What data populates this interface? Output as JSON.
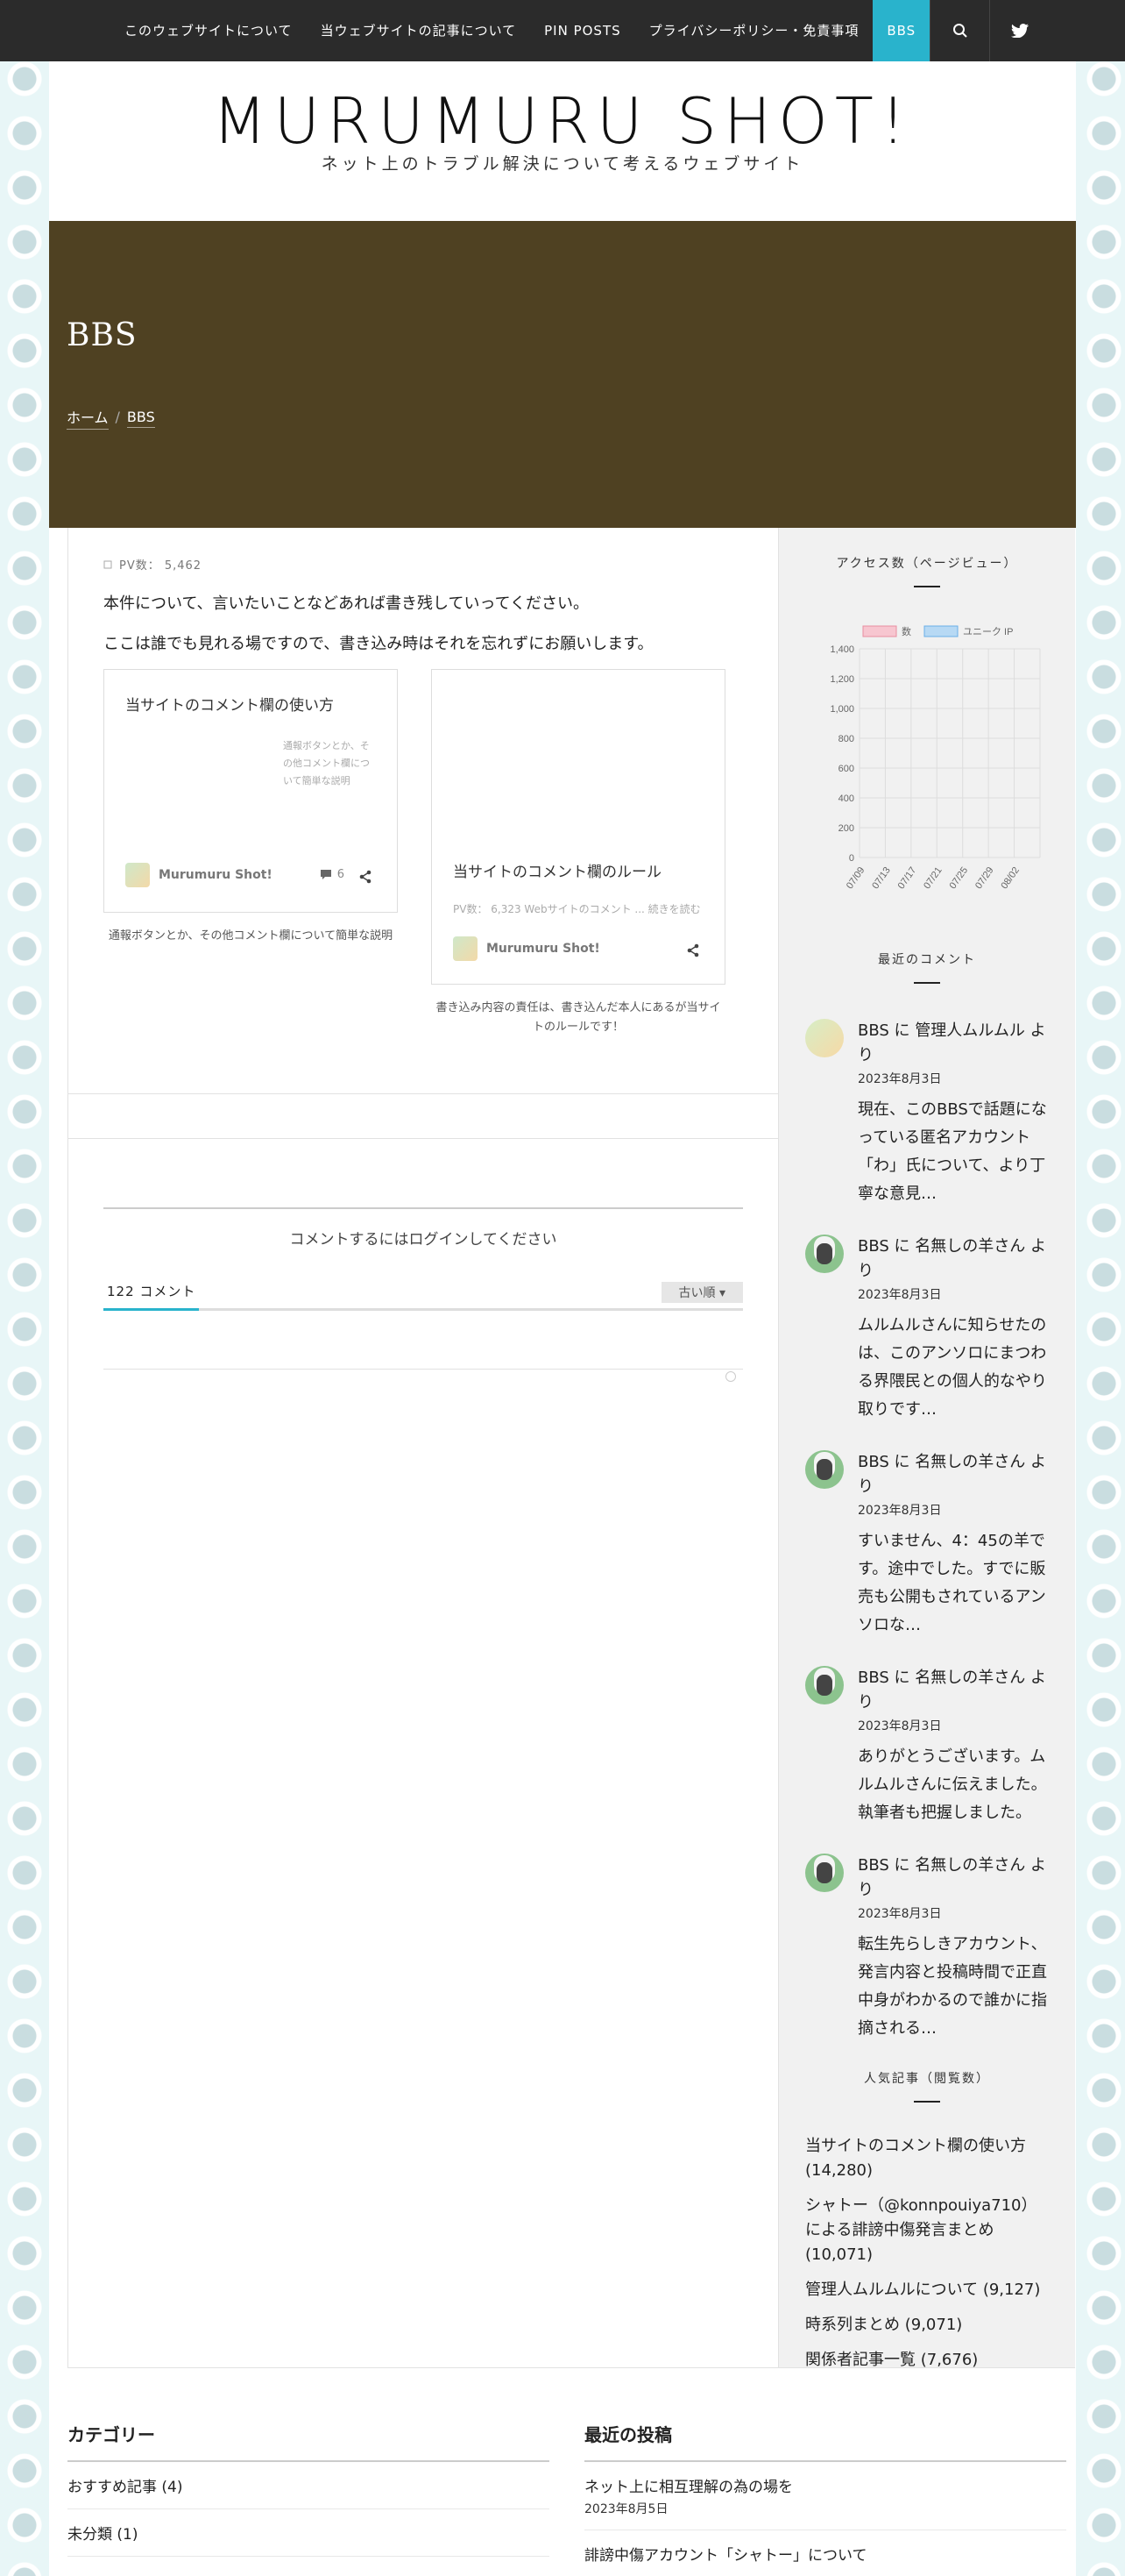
{
  "nav": {
    "items": [
      "このウェブサイトについて",
      "当ウェブサイトの記事について",
      "PIN POSTS",
      "プライバシーポリシー・免責事項",
      "BBS"
    ],
    "active": "BBS",
    "accent": "#29b3cc"
  },
  "site": {
    "title": "MURUMURU SHOT!",
    "description": "ネット上のトラブル解決について考えるウェブサイト"
  },
  "hero": {
    "title": "BBS",
    "breadcrumb": [
      "ホーム",
      "BBS"
    ],
    "bg": "#4f4122"
  },
  "post": {
    "pv": "PV数： 5,462",
    "paragraphs": [
      "本件について、言いたいことなどあれば書き残していってください。",
      "ここは誰でも見れる場ですので、書き込み時はそれを忘れずにお願いします。"
    ]
  },
  "cards": [
    {
      "title": "当サイトのコメント欄の使い方",
      "excerpt": "通報ボタンとか、その他コメント欄について簡単な説明",
      "author": "Murumuru Shot!",
      "comments": "6",
      "caption": "通報ボタンとか、その他コメント欄について簡単な説明"
    },
    {
      "title": "当サイトのコメント欄のルール",
      "excerpt": "PV数： 6,323 Webサイトのコメント ... 続きを読む",
      "author": "Murumuru Shot!",
      "caption": "書き込み内容の責任は、書き込んだ本人にあるが当サイトのルールです！"
    }
  ],
  "comments": {
    "login_prompt": "コメントするにはログインしてください",
    "count": "122 コメント",
    "sort": "古い順"
  },
  "sidebar": {
    "chart_title": "アクセス数（ページビュー）",
    "recent_title": "最近のコメント",
    "popular_title": "人気記事（閲覧数）",
    "recent": [
      {
        "head": "BBS に 管理人ムルムル より",
        "date": "2023年8月3日",
        "excerpt": "現在、このBBSで話題になっている匿名アカウント「わ」氏について、より丁寧な意見…",
        "avatar": "admin"
      },
      {
        "head": "BBS に 名無しの羊さん より",
        "date": "2023年8月3日",
        "excerpt": "ムルムルさんに知らせたのは、このアンソロにまつわる界隈民との個人的なやり取りです…",
        "avatar": "sheep"
      },
      {
        "head": "BBS に 名無しの羊さん より",
        "date": "2023年8月3日",
        "excerpt": "すいません、4：45の羊です。途中でした。すでに販売も公開もされているアンソロな…",
        "avatar": "sheep"
      },
      {
        "head": "BBS に 名無しの羊さん より",
        "date": "2023年8月3日",
        "excerpt": "ありがとうございます。ムルムルさんに伝えました。執筆者も把握しました。",
        "avatar": "sheep"
      },
      {
        "head": "BBS に 名無しの羊さん より",
        "date": "2023年8月3日",
        "excerpt": "転生先らしきアカウント、発言内容と投稿時間で正直中身がわかるので誰かに指摘される…",
        "avatar": "sheep"
      }
    ],
    "popular": [
      "当サイトのコメント欄の使い方 (14,280)",
      "シャトー（@konnpouiya710）による誹謗中傷発言まとめ (10,071)",
      "管理人ムルムルについて (9,127)",
      "時系列まとめ (9,071)",
      "関係者記事一覧 (7,676)"
    ]
  },
  "chart_data": {
    "type": "bar",
    "categories": [
      "07/09",
      "07/13",
      "07/17",
      "07/21",
      "07/25",
      "07/29",
      "08/02"
    ],
    "series": [
      {
        "name": "数",
        "values": [
          0,
          0,
          0,
          0,
          0,
          0,
          0
        ],
        "color": "#f7c6d0"
      },
      {
        "name": "ユニーク IP",
        "values": [
          0,
          0,
          0,
          0,
          0,
          0,
          0
        ],
        "color": "#b7d9f4"
      }
    ],
    "ylim": [
      0,
      1400
    ],
    "yticks": [
      0,
      200,
      400,
      600,
      800,
      1000,
      1200,
      1400
    ],
    "legend": "top",
    "grid": true
  },
  "footer": {
    "left_title": "カテゴリー",
    "left_items": [
      "おすすめ記事 (4)",
      "未分類 (1)"
    ],
    "right_title": "最近の投稿",
    "right_items": [
      {
        "title": "ネット上に相互理解の為の場を",
        "date": "2023年8月5日"
      },
      {
        "title": "誹謗中傷アカウント「シャトー」について",
        "date": ""
      }
    ]
  }
}
